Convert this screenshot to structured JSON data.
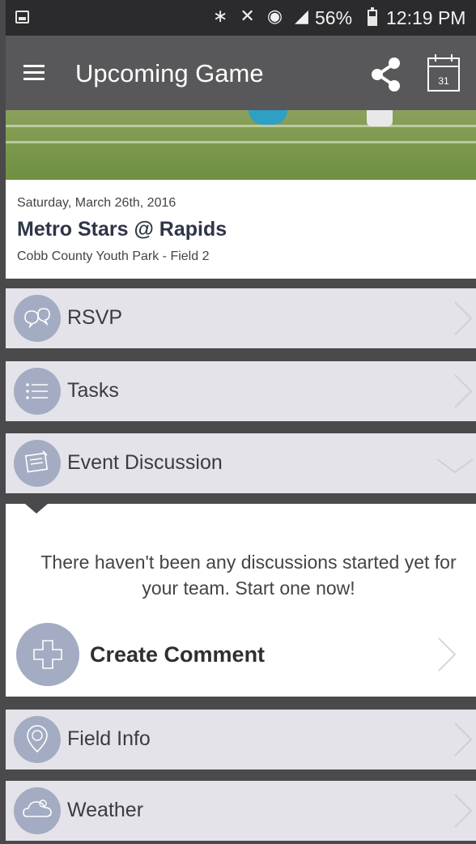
{
  "status_bar": {
    "icons_text": "∗ ✕ ◉ ◢",
    "battery_percent": "56%",
    "time": "12:19 PM"
  },
  "app_bar": {
    "title": "Upcoming Game",
    "calendar_day": "31"
  },
  "event": {
    "date": "Saturday, March 26th, 2016",
    "title": "Metro Stars @ Rapids",
    "location": "Cobb County Youth Park - Field 2"
  },
  "sections": {
    "rsvp": "RSVP",
    "tasks": "Tasks",
    "event_discussion": "Event Discussion",
    "field_info": "Field Info",
    "weather": "Weather"
  },
  "discussion": {
    "empty_message": "There haven't been any discussions started yet for your team. Start one now!",
    "create_label": "Create Comment"
  },
  "colors": {
    "app_bar": "#58585a",
    "status_bar": "#2b2b2d",
    "row_background": "#e4e3ea",
    "icon_circle": "#a3acc2",
    "divider": "#4a4a4c",
    "title_text": "#2e3547"
  }
}
